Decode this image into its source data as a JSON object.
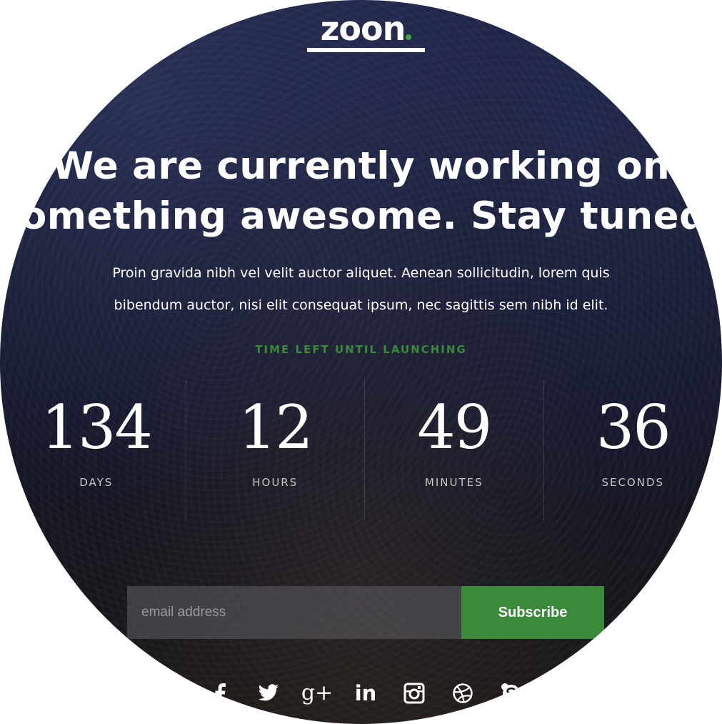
{
  "logo": {
    "text": "zoon"
  },
  "colors": {
    "accent": "#3b8a3a",
    "text": "#ffffff",
    "background": "#171a30"
  },
  "hero": {
    "headline_line1": "We are currently working on",
    "headline_line2": "something awesome. Stay tuned!",
    "body_line1": "Proin gravida nibh vel velit auctor aliquet. Aenean sollicitudin, lorem quis",
    "body_line2": "bibendum auctor, nisi elit consequat ipsum, nec sagittis sem nibh id elit."
  },
  "countdown": {
    "label": "TIME LEFT UNTIL LAUNCHING",
    "items": [
      {
        "value": "134",
        "unit": "DAYS"
      },
      {
        "value": "12",
        "unit": "HOURS"
      },
      {
        "value": "49",
        "unit": "MINUTES"
      },
      {
        "value": "36",
        "unit": "SECONDS"
      }
    ]
  },
  "subscribe": {
    "placeholder": "email address",
    "value": "",
    "button_label": "Subscribe"
  },
  "social": {
    "icons": [
      "facebook-icon",
      "twitter-icon",
      "google-plus-icon",
      "linkedin-icon",
      "instagram-icon",
      "dribbble-icon",
      "skype-icon"
    ],
    "google_plus_glyph": "g+",
    "linkedin_glyph": "in"
  }
}
